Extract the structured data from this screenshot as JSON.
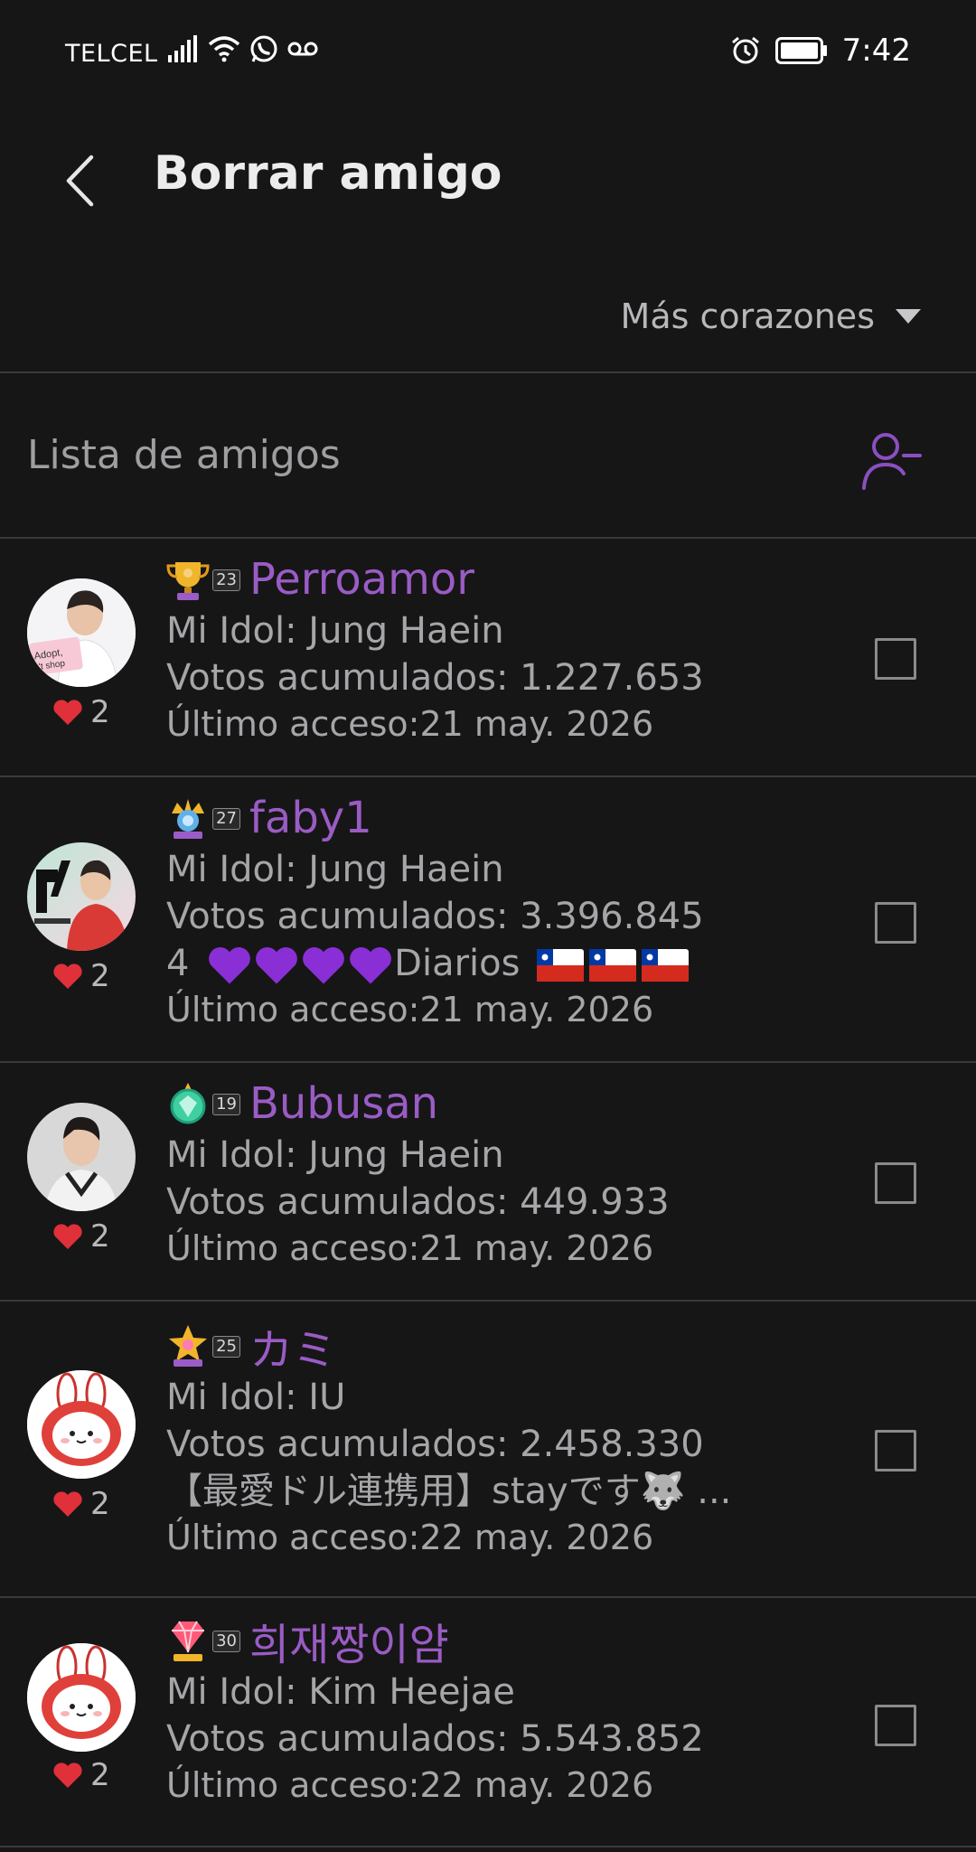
{
  "status": {
    "carrier": "TELCEL",
    "time": "7:42"
  },
  "header": {
    "title": "Borrar amigo",
    "back_icon": "chevron-left-icon"
  },
  "sort": {
    "label": "Más corazones"
  },
  "section": {
    "title": "Lista de amigos",
    "action_icon": "remove-user-icon"
  },
  "colors": {
    "background": "#161617",
    "name": "#9a5cc4",
    "heart": "#e0303a",
    "accent": "#8a4fc0"
  },
  "friends": [
    {
      "name": "Perroamor",
      "level": "23",
      "badge_icon": "trophy-badge-icon",
      "hearts": "2",
      "idol": "Mi Idol: Jung Haein",
      "votes": "Votos acumulados: 1.227.653",
      "status": "",
      "last_access": "Último acceso:21 may. 2026",
      "avatar_text": "Adopt, n't shop"
    },
    {
      "name": "faby1",
      "level": "27",
      "badge_icon": "crown-badge-icon",
      "hearts": "2",
      "idol": "Mi Idol: Jung Haein",
      "votes": "Votos acumulados: 3.396.845",
      "status_prefix": "4",
      "status_suffix": "Diarios",
      "last_access": "Último acceso:21 may. 2026"
    },
    {
      "name": "Bubusan",
      "level": "19",
      "badge_icon": "gem-badge-icon",
      "hearts": "2",
      "idol": "Mi Idol: Jung Haein",
      "votes": "Votos acumulados: 449.933",
      "last_access": "Último acceso:21 may. 2026"
    },
    {
      "name": "カミ",
      "level": "25",
      "badge_icon": "star-badge-icon",
      "hearts": "2",
      "idol": "Mi Idol: IU",
      "votes": "Votos acumulados: 2.458.330",
      "status": "【最愛ドル連携用】stayです🐺 ...",
      "last_access": "Último acceso:22 may. 2026"
    },
    {
      "name": "희재짱이얌",
      "level": "30",
      "badge_icon": "diamond-badge-icon",
      "hearts": "2",
      "idol": "Mi Idol: Kim Heejae",
      "votes": "Votos acumulados: 5.543.852",
      "last_access": "Último acceso:22 may. 2026"
    }
  ]
}
